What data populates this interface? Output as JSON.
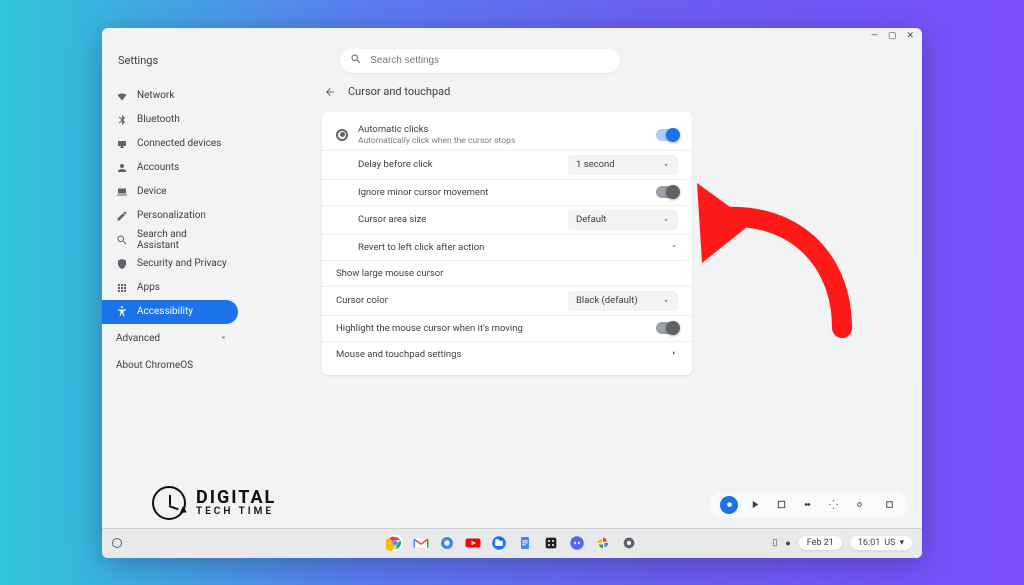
{
  "window": {
    "app_title": "Settings",
    "search_placeholder": "Search settings"
  },
  "sidebar": {
    "items": [
      {
        "label": "Network"
      },
      {
        "label": "Bluetooth"
      },
      {
        "label": "Connected devices"
      },
      {
        "label": "Accounts"
      },
      {
        "label": "Device"
      },
      {
        "label": "Personalization"
      },
      {
        "label": "Search and Assistant"
      },
      {
        "label": "Security and Privacy"
      },
      {
        "label": "Apps"
      },
      {
        "label": "Accessibility"
      }
    ],
    "advanced_label": "Advanced",
    "about_label": "About ChromeOS"
  },
  "panel": {
    "title": "Cursor and touchpad",
    "auto_clicks": {
      "title": "Automatic clicks",
      "subtitle": "Automatically click when the cursor stops"
    },
    "delay": {
      "label": "Delay before click",
      "value": "1 second"
    },
    "ignore_minor": "Ignore minor cursor movement",
    "cursor_area": {
      "label": "Cursor area size",
      "value": "Default"
    },
    "revert": "Revert to left click after action",
    "large_cursor": "Show large mouse cursor",
    "cursor_color": {
      "label": "Cursor color",
      "value": "Black (default)"
    },
    "highlight_moving": "Highlight the mouse cursor when it's moving",
    "mouse_settings": "Mouse and touchpad settings"
  },
  "logo": {
    "line1": "DIGITAL",
    "line2": "TECH TIME"
  },
  "tray": {
    "date": "Feb 21",
    "time": "16:01",
    "locale": "US"
  }
}
